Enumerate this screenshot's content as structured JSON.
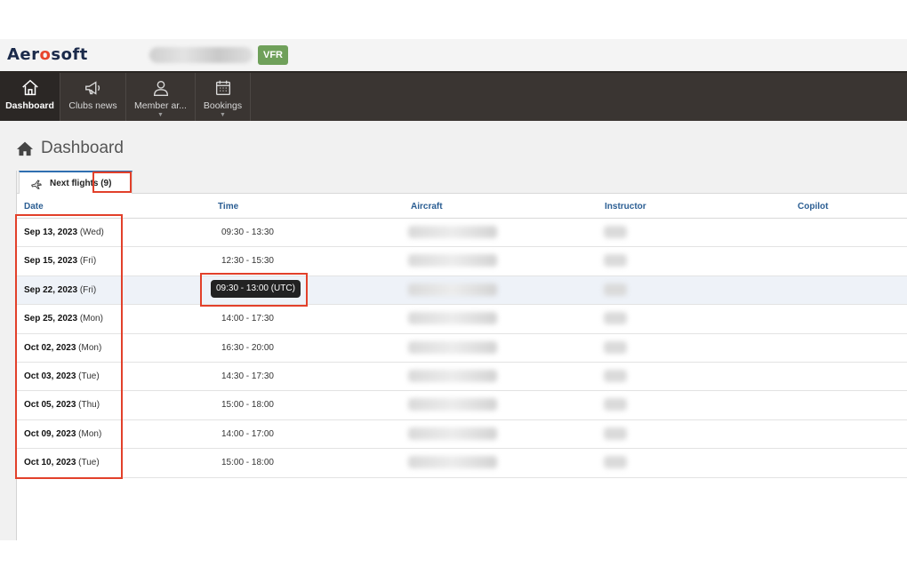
{
  "brand": {
    "logo_prefix": "Aer",
    "logo_dot": "o",
    "logo_suffix": "soft",
    "badge": "VFR"
  },
  "nav": {
    "items": [
      {
        "label": "Dashboard",
        "icon": "home-icon",
        "active": true
      },
      {
        "label": "Clubs news",
        "icon": "megaphone-icon"
      },
      {
        "label": "Member ar...",
        "icon": "user-icon",
        "dropdown": true
      },
      {
        "label": "Bookings",
        "icon": "calendar-icon",
        "dropdown": true
      }
    ]
  },
  "page": {
    "title": "Dashboard"
  },
  "tab": {
    "label": "Next flights (9)"
  },
  "table": {
    "headers": [
      "Date",
      "Time",
      "Aircraft",
      "Instructor",
      "Copilot"
    ],
    "rows": [
      {
        "date": "Sep 13, 2023",
        "day": "(Wed)",
        "time": "09:30 - 13:30"
      },
      {
        "date": "Sep 15, 2023",
        "day": "(Fri)",
        "time": "12:30 - 15:30"
      },
      {
        "date": "Sep 22, 2023",
        "day": "(Fri)",
        "time": "09:30 - 13:00 (UTC)"
      },
      {
        "date": "Sep 25, 2023",
        "day": "(Mon)",
        "time": "14:00 - 17:30"
      },
      {
        "date": "Oct 02, 2023",
        "day": "(Mon)",
        "time": "16:30 - 20:00"
      },
      {
        "date": "Oct 03, 2023",
        "day": "(Tue)",
        "time": "14:30 - 17:30"
      },
      {
        "date": "Oct 05, 2023",
        "day": "(Thu)",
        "time": "15:00 - 18:00"
      },
      {
        "date": "Oct 09, 2023",
        "day": "(Mon)",
        "time": "14:00 - 17:00"
      },
      {
        "date": "Oct 10, 2023",
        "day": "(Tue)",
        "time": "15:00 - 18:00"
      }
    ]
  },
  "colors": {
    "nav_bg": "#3a3532",
    "accent_blue": "#2b5e93",
    "badge_green": "#6fa05a",
    "annotation_red": "#e2402a"
  }
}
